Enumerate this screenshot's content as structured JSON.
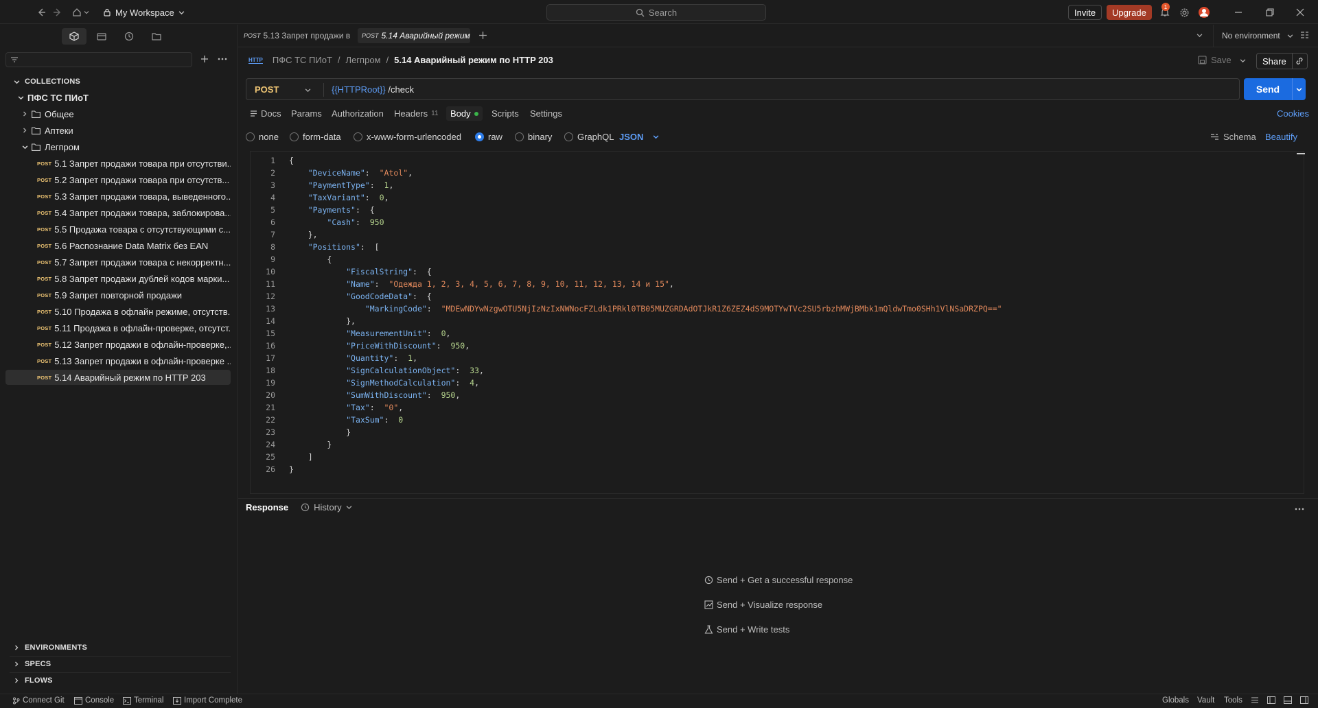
{
  "titlebar": {
    "workspace": "My Workspace",
    "search_placeholder": "Search",
    "invite": "Invite",
    "upgrade": "Upgrade",
    "notification_count": "1"
  },
  "sidebar": {
    "sections": {
      "collections": "COLLECTIONS",
      "environments": "ENVIRONMENTS",
      "specs": "SPECS",
      "flows": "FLOWS"
    },
    "collection_name": "ПФС ТС ПИоТ",
    "folders": [
      "Общее",
      "Аптеки",
      "Легпром"
    ],
    "method_label": "POST",
    "requests": [
      "5.1 Запрет продажи товара при отсутстви...",
      "5.2 Запрет продажи товара при отсутств...",
      "5.3 Запрет продажи товара, выведенного...",
      "5.4 Запрет продажи товара, заблокирова...",
      "5.5 Продажа товара с отсутствующими с...",
      "5.6 Распознание Data Matrix без EAN",
      "5.7 Запрет продажи товара с некорректн...",
      "5.8 Запрет продажи дублей кодов марки...",
      "5.9 Запрет повторной продажи",
      "5.10 Продажа в офлайн режиме, отсутств...",
      "5.11 Продажа в офлайн-проверке, отсутст...",
      "5.12 Запрет продажи в офлайн-проверке,...",
      "5.13 Запрет продажи в офлайн-проверке ...",
      "5.14 Аварийный режим по HTTP 203"
    ]
  },
  "tabs": [
    {
      "method": "POST",
      "label": "5.13 Запрет продажи в"
    },
    {
      "method": "POST",
      "label": "5.14 Аварийный режим"
    }
  ],
  "environment": "No environment",
  "breadcrumb": {
    "collection": "ПФС ТС ПИоТ",
    "folder": "Легпром",
    "current": "5.14 Аварийный режим по HTTP 203"
  },
  "actions": {
    "save": "Save",
    "share": "Share",
    "send": "Send",
    "cookies": "Cookies"
  },
  "request": {
    "method": "POST",
    "url_var": "{{HTTPRoot}}",
    "url_path": " /check"
  },
  "subtabs": {
    "docs": "Docs",
    "params": "Params",
    "authorization": "Authorization",
    "headers": "Headers",
    "headers_count": "11",
    "body": "Body",
    "scripts": "Scripts",
    "settings": "Settings"
  },
  "body_types": [
    "none",
    "form-data",
    "x-www-form-urlencoded",
    "raw",
    "binary",
    "GraphQL"
  ],
  "body_format": "JSON",
  "schema": "Schema",
  "beautify": "Beautify",
  "code_lines": [
    "{",
    "    \"DeviceName\":  \"Atol\",",
    "    \"PaymentType\":  1,",
    "    \"TaxVariant\":  0,",
    "    \"Payments\":  {",
    "        \"Cash\":  950",
    "    },",
    "    \"Positions\":  [",
    "        {",
    "            \"FiscalString\":  {",
    "            \"Name\":  \"Одежда 1, 2, 3, 4, 5, 6, 7, 8, 9, 10, 11, 12, 13, 14 и 15\",",
    "            \"GoodCodeData\":  {",
    "                \"MarkingCode\":  \"MDEwNDYwNzgwOTU5NjIzNzIxNWNocFZLdk1PRkl0TB05MUZGRDAdOTJkR1Z6ZEZ4dS9MOTYwTVc2SU5rbzhMWjBMbk1mQldwTmo0SHh1VlNSaDRZPQ==\"",
    "            },",
    "            \"MeasurementUnit\":  0,",
    "            \"PriceWithDiscount\":  950,",
    "            \"Quantity\":  1,",
    "            \"SignCalculationObject\":  33,",
    "            \"SignMethodCalculation\":  4,",
    "            \"SumWithDiscount\":  950,",
    "            \"Tax\":  \"0\",",
    "            \"TaxSum\":  0",
    "            }",
    "        }",
    "    ]",
    "}"
  ],
  "response": {
    "title": "Response",
    "history": "History",
    "hints": [
      "Send + Get a successful response",
      "Send + Visualize response",
      "Send + Write tests"
    ]
  },
  "statusbar": {
    "connect_git": "Connect Git",
    "console": "Console",
    "terminal": "Terminal",
    "import": "Import Complete",
    "globals": "Globals",
    "vault": "Vault",
    "tools": "Tools"
  },
  "colors": {
    "send": "#1b6be0",
    "upgrade": "#a33a25",
    "method_post": "#f0c674",
    "json_key": "#7cb4f2",
    "json_string": "#e2895c"
  }
}
